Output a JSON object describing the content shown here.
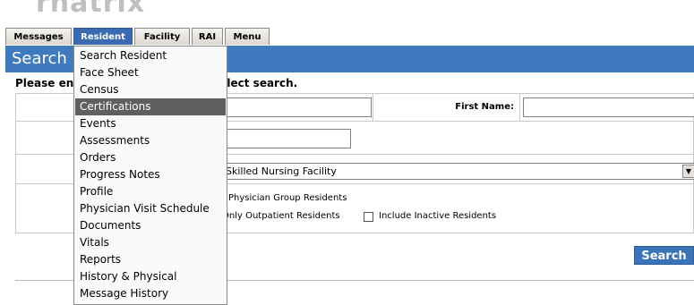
{
  "app": {
    "logo_text": "rnatrix"
  },
  "tabs": [
    {
      "label": "Messages",
      "active": false
    },
    {
      "label": "Resident",
      "active": true
    },
    {
      "label": "Facility",
      "active": false
    },
    {
      "label": "RAI",
      "active": false
    },
    {
      "label": "Menu",
      "active": false
    }
  ],
  "header": {
    "title": "Search Resident"
  },
  "form": {
    "instruction": "Please enter search criteria and select search.",
    "first_name_label": "First Name:",
    "facility_value": "Skilled Nursing Facility",
    "options": {
      "physician_group": "Physician Group Residents",
      "outpatient": "Only Outpatient Residents",
      "include_inactive": "Include Inactive Residents"
    },
    "search_button": "Search"
  },
  "menu": {
    "items": [
      {
        "label": "Search Resident",
        "highlighted": false
      },
      {
        "label": "Face Sheet",
        "highlighted": false
      },
      {
        "label": "Census",
        "highlighted": false
      },
      {
        "label": "Certifications",
        "highlighted": true
      },
      {
        "label": "Events",
        "highlighted": false
      },
      {
        "label": "Assessments",
        "highlighted": false
      },
      {
        "label": "Orders",
        "highlighted": false
      },
      {
        "label": "Progress Notes",
        "highlighted": false
      },
      {
        "label": "Profile",
        "highlighted": false
      },
      {
        "label": "Physician Visit Schedule",
        "highlighted": false
      },
      {
        "label": "Documents",
        "highlighted": false
      },
      {
        "label": "Vitals",
        "highlighted": false
      },
      {
        "label": "Reports",
        "highlighted": false
      },
      {
        "label": "History & Physical",
        "highlighted": false
      },
      {
        "label": "Message History",
        "highlighted": false
      }
    ]
  },
  "colors": {
    "accent": "#3f79be",
    "menu_highlight": "#5f5f5f"
  }
}
